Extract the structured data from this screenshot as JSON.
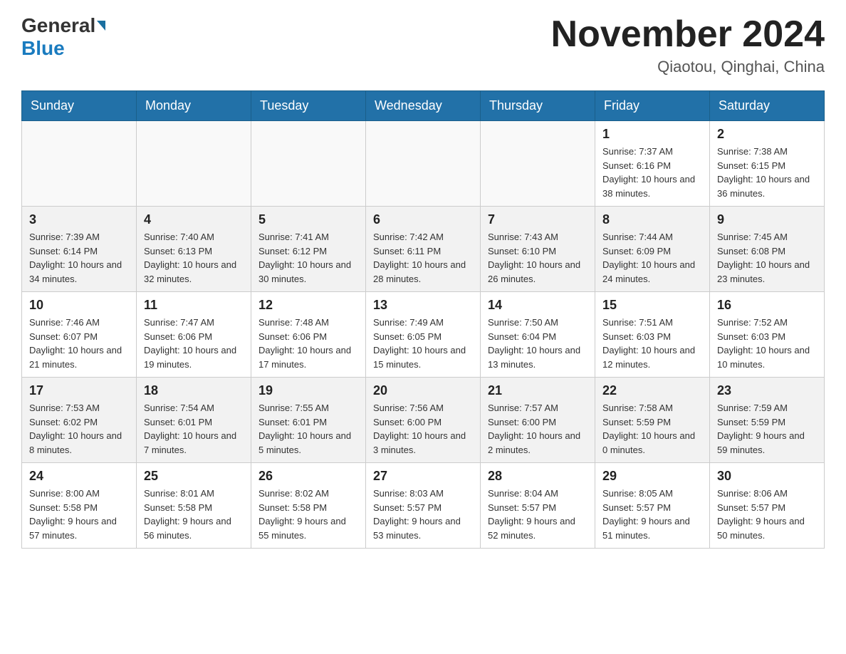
{
  "logo": {
    "general": "General",
    "blue": "Blue"
  },
  "header": {
    "month_title": "November 2024",
    "location": "Qiaotou, Qinghai, China"
  },
  "days_of_week": [
    "Sunday",
    "Monday",
    "Tuesday",
    "Wednesday",
    "Thursday",
    "Friday",
    "Saturday"
  ],
  "weeks": [
    [
      {
        "day": "",
        "info": ""
      },
      {
        "day": "",
        "info": ""
      },
      {
        "day": "",
        "info": ""
      },
      {
        "day": "",
        "info": ""
      },
      {
        "day": "",
        "info": ""
      },
      {
        "day": "1",
        "info": "Sunrise: 7:37 AM\nSunset: 6:16 PM\nDaylight: 10 hours and 38 minutes."
      },
      {
        "day": "2",
        "info": "Sunrise: 7:38 AM\nSunset: 6:15 PM\nDaylight: 10 hours and 36 minutes."
      }
    ],
    [
      {
        "day": "3",
        "info": "Sunrise: 7:39 AM\nSunset: 6:14 PM\nDaylight: 10 hours and 34 minutes."
      },
      {
        "day": "4",
        "info": "Sunrise: 7:40 AM\nSunset: 6:13 PM\nDaylight: 10 hours and 32 minutes."
      },
      {
        "day": "5",
        "info": "Sunrise: 7:41 AM\nSunset: 6:12 PM\nDaylight: 10 hours and 30 minutes."
      },
      {
        "day": "6",
        "info": "Sunrise: 7:42 AM\nSunset: 6:11 PM\nDaylight: 10 hours and 28 minutes."
      },
      {
        "day": "7",
        "info": "Sunrise: 7:43 AM\nSunset: 6:10 PM\nDaylight: 10 hours and 26 minutes."
      },
      {
        "day": "8",
        "info": "Sunrise: 7:44 AM\nSunset: 6:09 PM\nDaylight: 10 hours and 24 minutes."
      },
      {
        "day": "9",
        "info": "Sunrise: 7:45 AM\nSunset: 6:08 PM\nDaylight: 10 hours and 23 minutes."
      }
    ],
    [
      {
        "day": "10",
        "info": "Sunrise: 7:46 AM\nSunset: 6:07 PM\nDaylight: 10 hours and 21 minutes."
      },
      {
        "day": "11",
        "info": "Sunrise: 7:47 AM\nSunset: 6:06 PM\nDaylight: 10 hours and 19 minutes."
      },
      {
        "day": "12",
        "info": "Sunrise: 7:48 AM\nSunset: 6:06 PM\nDaylight: 10 hours and 17 minutes."
      },
      {
        "day": "13",
        "info": "Sunrise: 7:49 AM\nSunset: 6:05 PM\nDaylight: 10 hours and 15 minutes."
      },
      {
        "day": "14",
        "info": "Sunrise: 7:50 AM\nSunset: 6:04 PM\nDaylight: 10 hours and 13 minutes."
      },
      {
        "day": "15",
        "info": "Sunrise: 7:51 AM\nSunset: 6:03 PM\nDaylight: 10 hours and 12 minutes."
      },
      {
        "day": "16",
        "info": "Sunrise: 7:52 AM\nSunset: 6:03 PM\nDaylight: 10 hours and 10 minutes."
      }
    ],
    [
      {
        "day": "17",
        "info": "Sunrise: 7:53 AM\nSunset: 6:02 PM\nDaylight: 10 hours and 8 minutes."
      },
      {
        "day": "18",
        "info": "Sunrise: 7:54 AM\nSunset: 6:01 PM\nDaylight: 10 hours and 7 minutes."
      },
      {
        "day": "19",
        "info": "Sunrise: 7:55 AM\nSunset: 6:01 PM\nDaylight: 10 hours and 5 minutes."
      },
      {
        "day": "20",
        "info": "Sunrise: 7:56 AM\nSunset: 6:00 PM\nDaylight: 10 hours and 3 minutes."
      },
      {
        "day": "21",
        "info": "Sunrise: 7:57 AM\nSunset: 6:00 PM\nDaylight: 10 hours and 2 minutes."
      },
      {
        "day": "22",
        "info": "Sunrise: 7:58 AM\nSunset: 5:59 PM\nDaylight: 10 hours and 0 minutes."
      },
      {
        "day": "23",
        "info": "Sunrise: 7:59 AM\nSunset: 5:59 PM\nDaylight: 9 hours and 59 minutes."
      }
    ],
    [
      {
        "day": "24",
        "info": "Sunrise: 8:00 AM\nSunset: 5:58 PM\nDaylight: 9 hours and 57 minutes."
      },
      {
        "day": "25",
        "info": "Sunrise: 8:01 AM\nSunset: 5:58 PM\nDaylight: 9 hours and 56 minutes."
      },
      {
        "day": "26",
        "info": "Sunrise: 8:02 AM\nSunset: 5:58 PM\nDaylight: 9 hours and 55 minutes."
      },
      {
        "day": "27",
        "info": "Sunrise: 8:03 AM\nSunset: 5:57 PM\nDaylight: 9 hours and 53 minutes."
      },
      {
        "day": "28",
        "info": "Sunrise: 8:04 AM\nSunset: 5:57 PM\nDaylight: 9 hours and 52 minutes."
      },
      {
        "day": "29",
        "info": "Sunrise: 8:05 AM\nSunset: 5:57 PM\nDaylight: 9 hours and 51 minutes."
      },
      {
        "day": "30",
        "info": "Sunrise: 8:06 AM\nSunset: 5:57 PM\nDaylight: 9 hours and 50 minutes."
      }
    ]
  ]
}
